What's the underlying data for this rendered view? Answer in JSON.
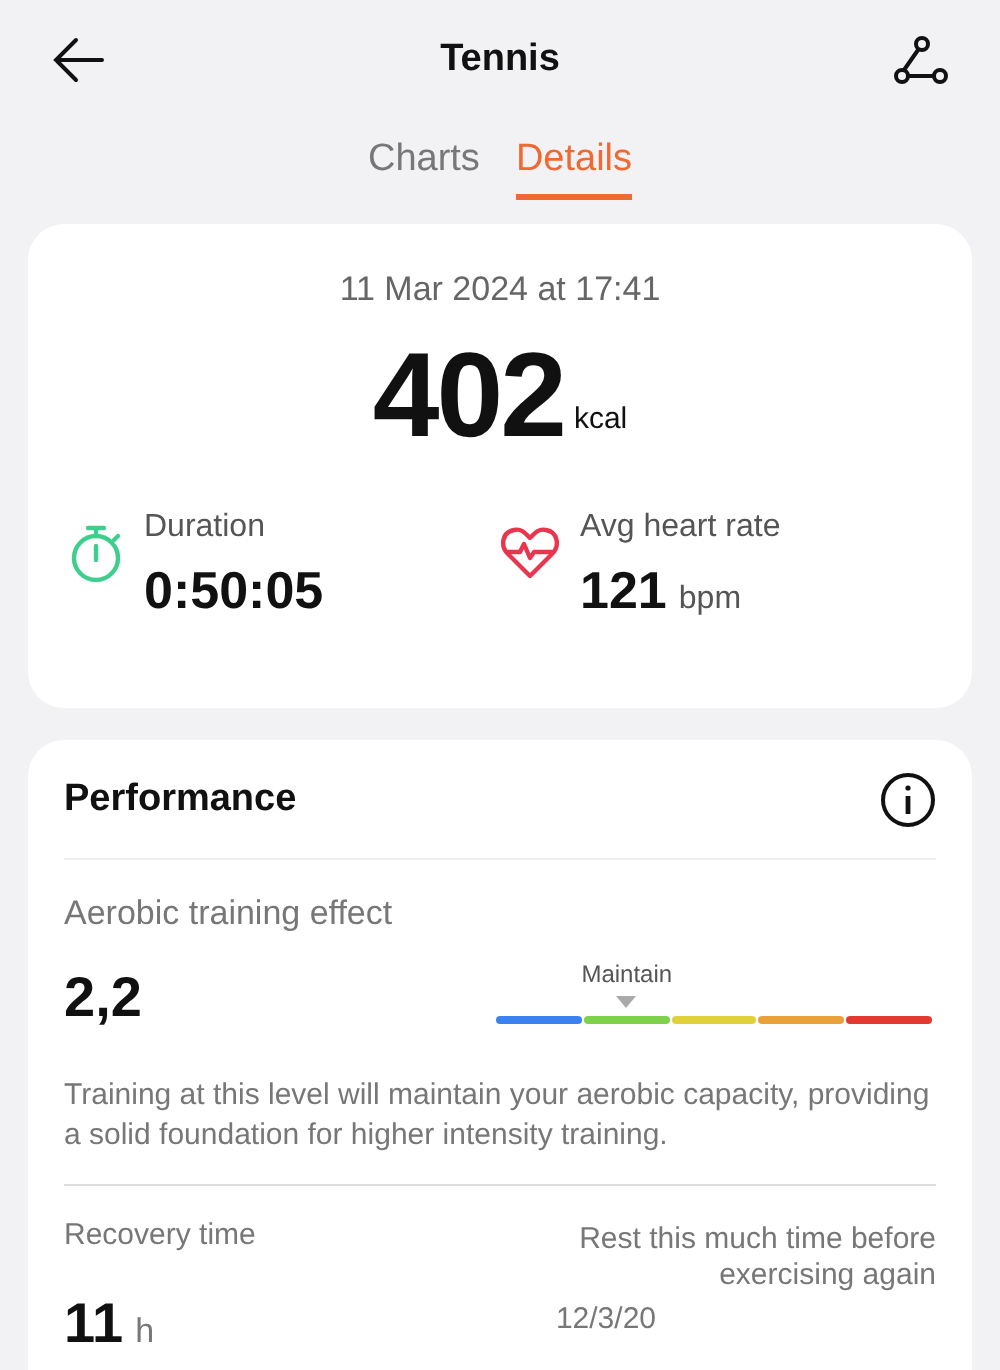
{
  "header": {
    "title": "Tennis"
  },
  "tabs": [
    {
      "label": "Charts",
      "selected": false
    },
    {
      "label": "Details",
      "selected": true
    }
  ],
  "summary": {
    "date": "11 Mar 2024 at 17:41",
    "calories": "402",
    "calories_unit": "kcal",
    "stats": [
      {
        "kind": "duration",
        "label": "Duration",
        "value": "0:50:05"
      },
      {
        "kind": "heart",
        "label": "Avg heart rate",
        "value": "121",
        "unit": "bpm"
      }
    ]
  },
  "performance": {
    "title": "Performance",
    "aerobic": {
      "label": "Aerobic training effect",
      "value": "2,2",
      "marker_label": "Maintain",
      "segments": [
        {
          "color": "#3b82f0"
        },
        {
          "color": "#7ed14a"
        },
        {
          "color": "#e0d03a"
        },
        {
          "color": "#eba13a"
        },
        {
          "color": "#e23a30"
        }
      ],
      "description": "Training at this level will maintain your aerobic capacity, providing a solid foundation for higher intensity training."
    },
    "recovery": {
      "label": "Recovery time",
      "value": "11",
      "unit": "h",
      "note": "Rest this much time before exercising again",
      "until": "12/3/20"
    }
  }
}
